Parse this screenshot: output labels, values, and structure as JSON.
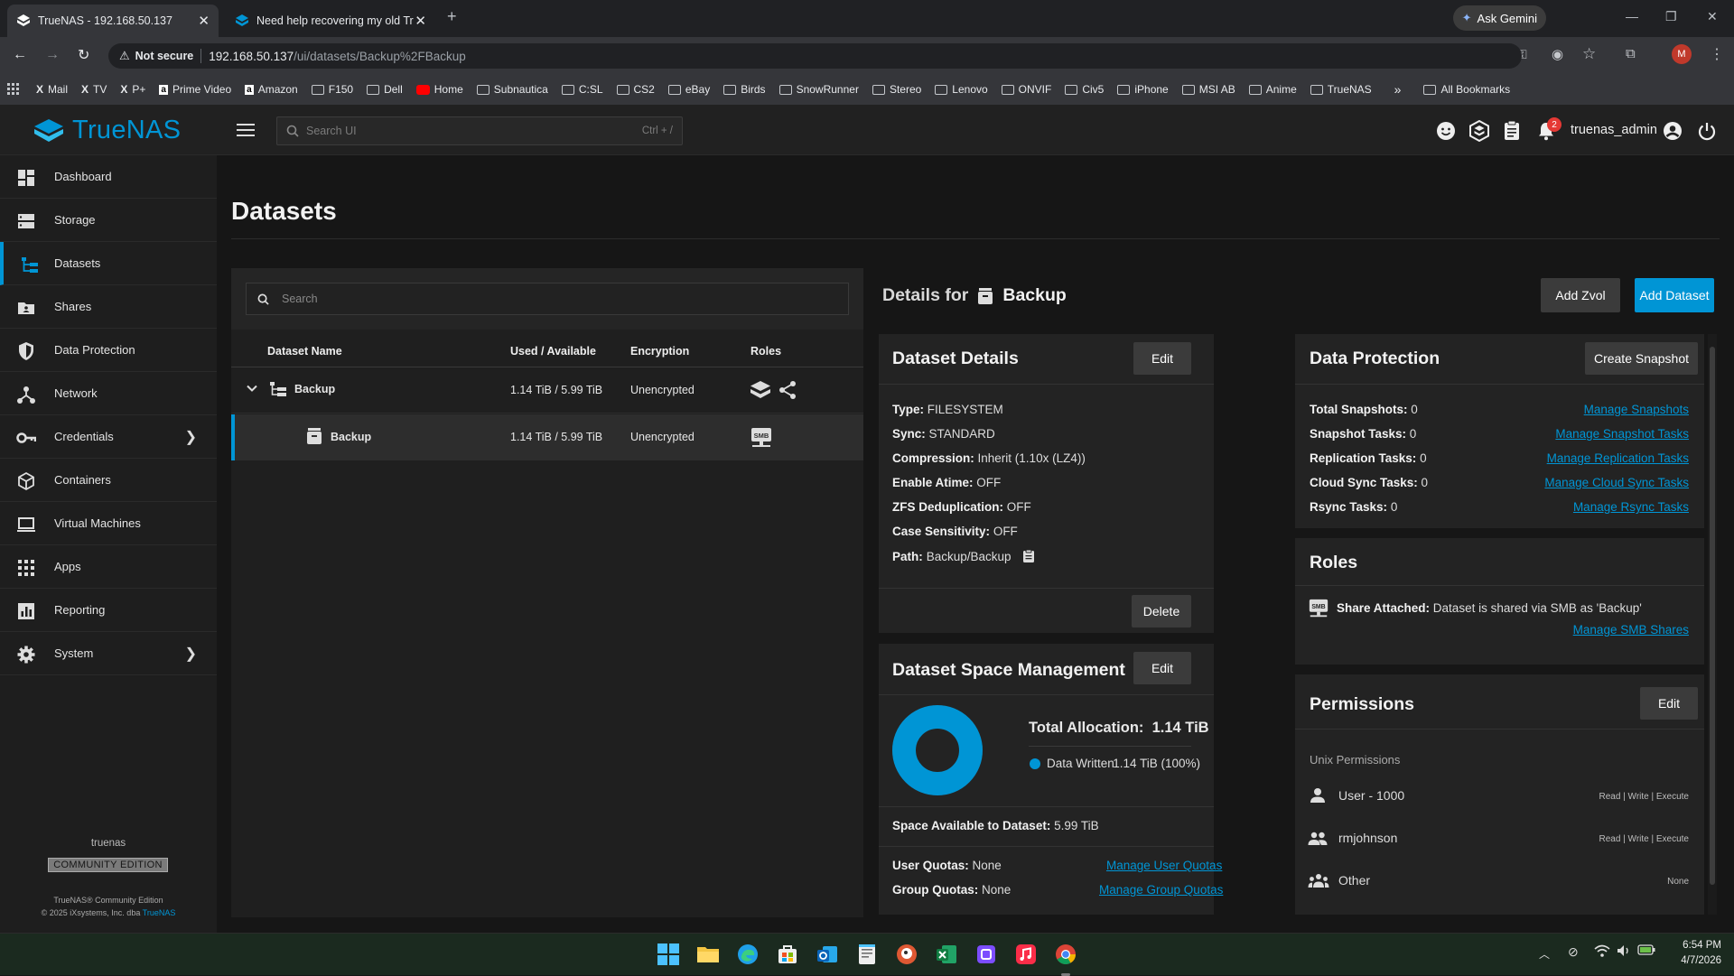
{
  "browser": {
    "tabs": [
      {
        "label": "TrueNAS - 192.168.50.137"
      },
      {
        "label": "Need help recovering my old Tr"
      }
    ],
    "ask_gemini": "Ask Gemini",
    "not_secure": "Not secure",
    "url_host": "192.168.50.137",
    "url_path": "/ui/datasets/Backup%2FBackup",
    "profile_initial": "M",
    "bookmarks": [
      "Mail",
      "TV",
      "P+",
      "Prime Video",
      "Amazon",
      "F150",
      "Dell",
      "Home",
      "Subnautica",
      "C:SL",
      "CS2",
      "eBay",
      "Birds",
      "SnowRunner",
      "Stereo",
      "Lenovo",
      "ONVIF",
      "Civ5",
      "iPhone",
      "MSI AB",
      "Anime",
      "TrueNAS"
    ],
    "all_bookmarks": "All Bookmarks"
  },
  "header": {
    "logo": "TrueNAS",
    "search_placeholder": "Search UI",
    "search_shortcut": "Ctrl + /",
    "notification_count": "2",
    "username": "truenas_admin"
  },
  "sidebar": {
    "items": [
      {
        "label": "Dashboard"
      },
      {
        "label": "Storage"
      },
      {
        "label": "Datasets"
      },
      {
        "label": "Shares"
      },
      {
        "label": "Data Protection"
      },
      {
        "label": "Network"
      },
      {
        "label": "Credentials"
      },
      {
        "label": "Containers"
      },
      {
        "label": "Virtual Machines"
      },
      {
        "label": "Apps"
      },
      {
        "label": "Reporting"
      },
      {
        "label": "System"
      }
    ],
    "hostname": "truenas",
    "edition": "COMMUNITY EDITION",
    "footer_line1": "TrueNAS® Community Edition",
    "footer_line2": "© 2025 iXsystems, Inc. dba",
    "footer_link": "TrueNAS"
  },
  "page": {
    "title": "Datasets",
    "details_for": "Details for",
    "selected_dataset": "Backup",
    "add_zvol": "Add Zvol",
    "add_dataset": "Add Dataset"
  },
  "tree": {
    "search_placeholder": "Search",
    "columns": [
      "Dataset Name",
      "Used / Available",
      "Encryption",
      "Roles"
    ],
    "rows": [
      {
        "name": "Backup",
        "used": "1.14 TiB / 5.99 TiB",
        "encryption": "Unencrypted"
      },
      {
        "name": "Backup",
        "used": "1.14 TiB / 5.99 TiB",
        "encryption": "Unencrypted"
      }
    ]
  },
  "dataset_details": {
    "title": "Dataset Details",
    "edit": "Edit",
    "delete": "Delete",
    "fields": [
      {
        "label": "Type:",
        "value": "FILESYSTEM"
      },
      {
        "label": "Sync:",
        "value": "STANDARD"
      },
      {
        "label": "Compression:",
        "value": "Inherit (1.10x (LZ4))"
      },
      {
        "label": "Enable Atime:",
        "value": "OFF"
      },
      {
        "label": "ZFS Deduplication:",
        "value": "OFF"
      },
      {
        "label": "Case Sensitivity:",
        "value": "OFF"
      },
      {
        "label": "Path:",
        "value": "Backup/Backup"
      }
    ]
  },
  "space": {
    "title": "Dataset Space Management",
    "edit": "Edit",
    "total_label": "Total Allocation:",
    "total_value": "1.14 TiB",
    "legend_label": "Data Written",
    "legend_value": "1.14 TiB (100%)",
    "written_fraction": 1.0,
    "color": "#0095d5",
    "available_label": "Space Available to Dataset:",
    "available_value": "5.99 TiB",
    "user_quotas_label": "User Quotas:",
    "user_quotas_value": "None",
    "group_quotas_label": "Group Quotas:",
    "group_quotas_value": "None",
    "manage_user_quotas": "Manage User Quotas",
    "manage_group_quotas": "Manage Group Quotas"
  },
  "data_protection": {
    "title": "Data Protection",
    "create_snapshot": "Create Snapshot",
    "rows": [
      {
        "label": "Total Snapshots:",
        "value": "0",
        "link": "Manage Snapshots"
      },
      {
        "label": "Snapshot Tasks:",
        "value": "0",
        "link": "Manage Snapshot Tasks"
      },
      {
        "label": "Replication Tasks:",
        "value": "0",
        "link": "Manage Replication Tasks"
      },
      {
        "label": "Cloud Sync Tasks:",
        "value": "0",
        "link": "Manage Cloud Sync Tasks"
      },
      {
        "label": "Rsync Tasks:",
        "value": "0",
        "link": "Manage Rsync Tasks"
      }
    ]
  },
  "roles": {
    "title": "Roles",
    "share_label": "Share Attached:",
    "share_value": "Dataset is shared via SMB as 'Backup'",
    "manage_link": "Manage SMB Shares"
  },
  "permissions": {
    "title": "Permissions",
    "edit": "Edit",
    "subtitle": "Unix Permissions",
    "entries": [
      {
        "name": "User - 1000",
        "perm": "Read | Write | Execute"
      },
      {
        "name": "rmjohnson",
        "perm": "Read | Write | Execute"
      },
      {
        "name": "Other",
        "perm": "None"
      }
    ]
  },
  "taskbar": {
    "time": "6:54 PM",
    "date": "4/7/2026"
  }
}
